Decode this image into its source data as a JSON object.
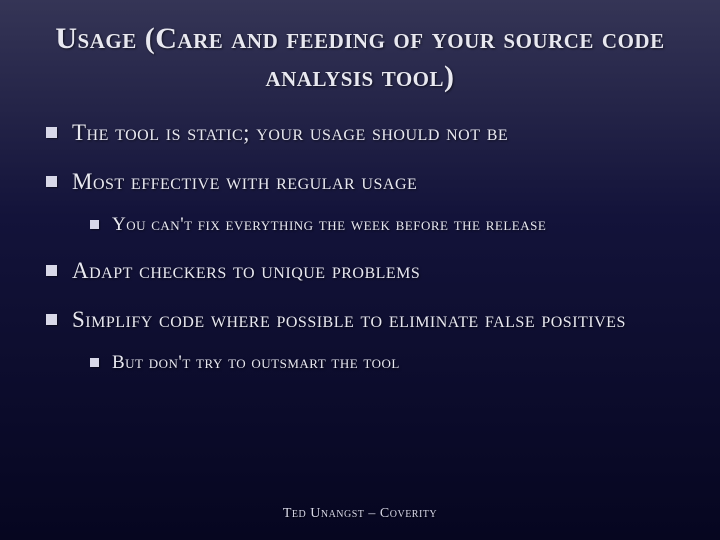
{
  "title": "Usage (Care and feeding of your source code analysis tool)",
  "bullets": {
    "b1": "The tool is static; your usage should not be",
    "b2": "Most effective with regular usage",
    "b2_sub1": "You can't fix everything the week before the release",
    "b3": "Adapt checkers to unique problems",
    "b4": "Simplify code where possible to eliminate false positives",
    "b4_sub1": "But don't try to outsmart the tool"
  },
  "footer": "Ted Unangst – Coverity"
}
